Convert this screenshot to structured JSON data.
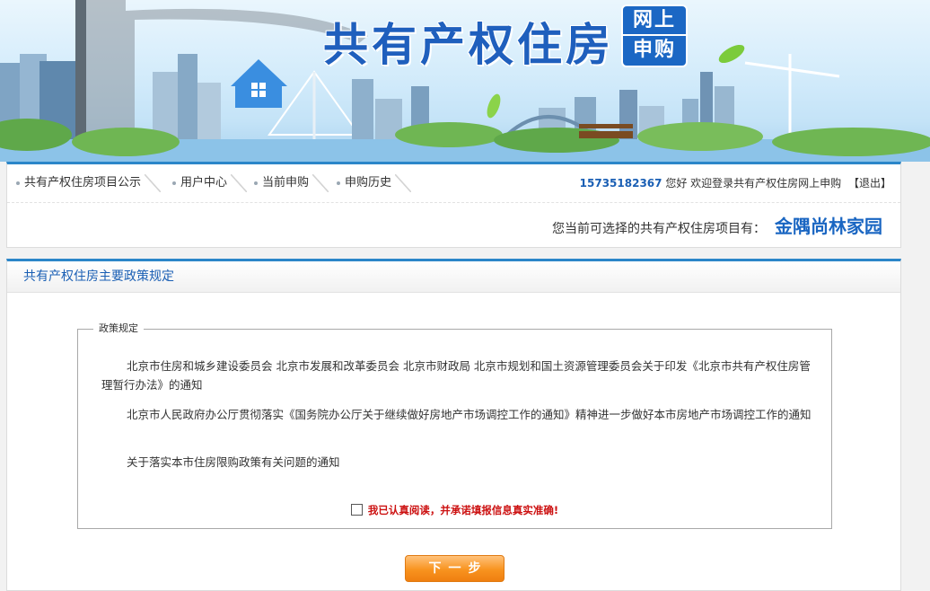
{
  "banner": {
    "title": "共有产权住房",
    "badge_top": "网上",
    "badge_bottom": "申购"
  },
  "nav": {
    "items": [
      {
        "label": "共有产权住房项目公示"
      },
      {
        "label": "用户中心"
      },
      {
        "label": "当前申购"
      },
      {
        "label": "申购历史"
      }
    ]
  },
  "user": {
    "phone": "15735182367",
    "greeting": "您好 欢迎登录共有产权住房网上申购",
    "logout": "【退出】"
  },
  "project": {
    "label": "您当前可选择的共有产权住房项目有：",
    "name": "金隅尚林家园"
  },
  "policy": {
    "heading": "共有产权住房主要政策规定",
    "legend": "政策规定",
    "items": [
      {
        "text": "北京市住房和城乡建设委员会 北京市发展和改革委员会 北京市财政局 北京市规划和国土资源管理委员会关于印发《北京市共有产权住房管理暂行办法》的通知"
      },
      {
        "text": "北京市人民政府办公厅贯彻落实《国务院办公厅关于继续做好房地产市场调控工作的通知》精神进一步做好本市房地产市场调控工作的通知"
      },
      {
        "text": "关于落实本市住房限购政策有关问题的通知"
      }
    ],
    "agree_text": "我已认真阅读，并承诺填报信息真实准确!",
    "agree_checked": false
  },
  "next_button": {
    "label": "下一步"
  },
  "colors": {
    "accent_blue": "#2b86c9",
    "title_blue": "#1f5fbd",
    "warning_red": "#cc1111",
    "button_orange": "#f8931f"
  }
}
